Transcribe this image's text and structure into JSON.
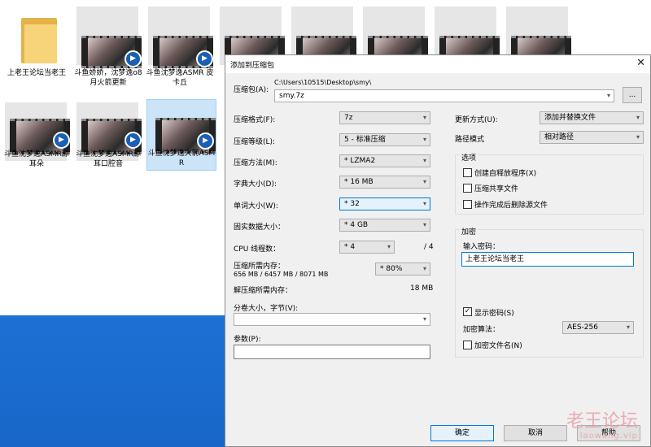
{
  "files": [
    {
      "kind": "folder",
      "caption": "上老王论坛当老王"
    },
    {
      "kind": "video",
      "caption": "斗鱼娇娇，沈梦逸o8月火箭更新"
    },
    {
      "kind": "video",
      "caption": "斗鱼沈梦逸ASMR 皮卡丘"
    },
    {
      "kind": "video",
      "caption": ""
    },
    {
      "kind": "video",
      "caption": ""
    },
    {
      "kind": "video",
      "caption": ""
    },
    {
      "kind": "video",
      "caption": ""
    },
    {
      "kind": "video",
      "caption": ""
    },
    {
      "kind": "video",
      "caption": "斗鱼沈梦逸ASMR舔耳朵"
    },
    {
      "kind": "video",
      "caption": "斗鱼沈梦逸ASMR舔耳口腔音"
    },
    {
      "kind": "video",
      "caption": "斗鱼沈梦逸火箭ASMR"
    }
  ],
  "dialog": {
    "title": "添加到压缩包",
    "archive_label": "压缩包(A):",
    "archive_path": "C:\\Users\\10515\\Desktop\\smy\\",
    "archive_name": "smy.7z",
    "browse_label": "...",
    "left": [
      {
        "label": "压缩格式(F):",
        "value": "7z"
      },
      {
        "label": "压缩等级(L):",
        "value": "5 - 标准压缩"
      },
      {
        "label": "压缩方法(M):",
        "value": "* LZMA2"
      },
      {
        "label": "字典大小(D):",
        "value": "* 16 MB"
      },
      {
        "label": "单词大小(W):",
        "value": "* 32"
      },
      {
        "label": "固实数据大小：",
        "value": "* 4 GB"
      }
    ],
    "cpu_label": "CPU 线程数：",
    "cpu_value": "* 4",
    "cpu_max": "/ 4",
    "mem_label": "压缩所需内存：",
    "mem_values": "656 MB / 6457 MB / 8071 MB",
    "mem_percent": "* 80%",
    "decomp_label": "解压缩所需内存：",
    "decomp_value": "18 MB",
    "volume_label": "分卷大小，字节(V):",
    "volume_value": "",
    "params_label": "参数(P):",
    "params_value": "",
    "update_label": "更新方式(U):",
    "update_value": "添加并替换文件",
    "path_label": "路径模式",
    "path_value": "相对路径",
    "options_title": "选项",
    "options": [
      {
        "label": "创建自释放程序(X)",
        "checked": false
      },
      {
        "label": "压缩共享文件",
        "checked": false
      },
      {
        "label": "操作完成后删除源文件",
        "checked": false
      }
    ],
    "encrypt_title": "加密",
    "password_label": "输入密码：",
    "password_value": "上老王论坛当老王",
    "show_password_label": "显示密码(S)",
    "show_password_checked": true,
    "algo_label": "加密算法：",
    "algo_value": "AES-256",
    "encrypt_names_label": "加密文件名(N)",
    "encrypt_names_checked": false,
    "ok_label": "确定",
    "cancel_label": "取消",
    "help_label": "帮助"
  },
  "watermark": {
    "line1": "老王论坛",
    "line2": "laowang.vip"
  }
}
